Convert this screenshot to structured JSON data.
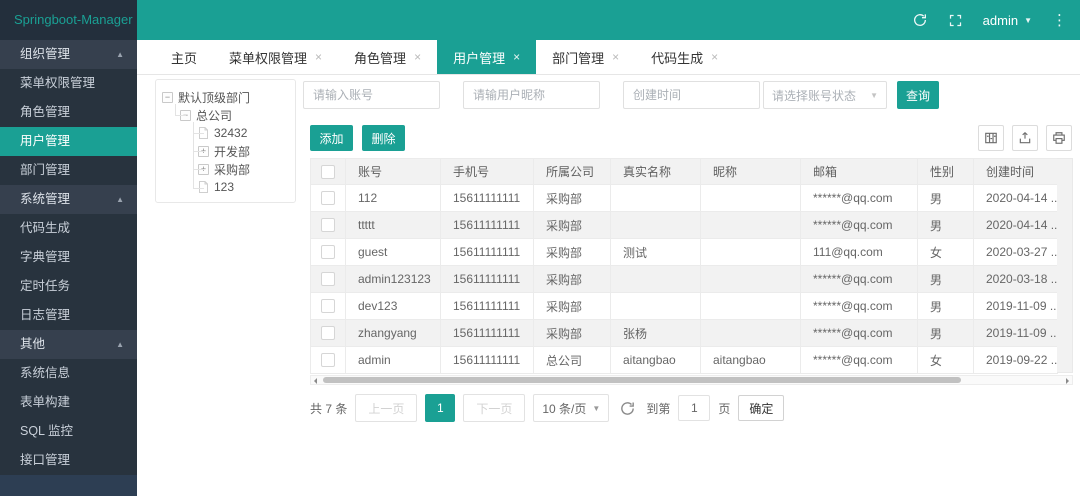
{
  "colors": {
    "primary": "#1AA094",
    "sidebar_bg": "#28333E",
    "sidebar_group_bg": "#36404E",
    "logo_bg": "#232F3C",
    "table_header_bg": "#F2F2F2",
    "border": "#E6E6E6"
  },
  "icons": {
    "close": "×",
    "caret_up": "▲",
    "caret_down": "▼",
    "more_vertical": "⋮",
    "collapse_minus": "−",
    "expand_plus": "+"
  },
  "logo": {
    "title": "Springboot-Manager"
  },
  "topbar": {
    "username": "admin"
  },
  "sidebar": {
    "items": [
      {
        "label": "组织管理",
        "type": "group"
      },
      {
        "label": "菜单权限管理",
        "type": "item"
      },
      {
        "label": "角色管理",
        "type": "item"
      },
      {
        "label": "用户管理",
        "type": "item",
        "active": true
      },
      {
        "label": "部门管理",
        "type": "item"
      },
      {
        "label": "系统管理",
        "type": "group"
      },
      {
        "label": "代码生成",
        "type": "item"
      },
      {
        "label": "字典管理",
        "type": "item"
      },
      {
        "label": "定时任务",
        "type": "item"
      },
      {
        "label": "日志管理",
        "type": "item"
      },
      {
        "label": "其他",
        "type": "group"
      },
      {
        "label": "系统信息",
        "type": "item"
      },
      {
        "label": "表单构建",
        "type": "item"
      },
      {
        "label": "SQL 监控",
        "type": "item"
      },
      {
        "label": "接口管理",
        "type": "item"
      }
    ]
  },
  "tabs": {
    "items": [
      {
        "label": "主页",
        "closable": false,
        "active": false
      },
      {
        "label": "菜单权限管理",
        "closable": true,
        "active": false
      },
      {
        "label": "角色管理",
        "closable": true,
        "active": false
      },
      {
        "label": "用户管理",
        "closable": true,
        "active": true
      },
      {
        "label": "部门管理",
        "closable": true,
        "active": false
      },
      {
        "label": "代码生成",
        "closable": true,
        "active": false
      }
    ]
  },
  "tree": {
    "nodes": [
      {
        "label": "默认顶级部门",
        "icon": "collapse"
      },
      {
        "label": "总公司",
        "icon": "collapse"
      },
      {
        "label": "32432",
        "icon": "file"
      },
      {
        "label": "开发部",
        "icon": "expand"
      },
      {
        "label": "采购部",
        "icon": "expand"
      },
      {
        "label": "123",
        "icon": "file"
      }
    ]
  },
  "filters": {
    "account_placeholder": "请输入账号",
    "nickname_placeholder": "请输用户昵称",
    "create_time_placeholder": "创建时间",
    "status_placeholder": "请选择账号状态",
    "search_label": "查询"
  },
  "toolbar": {
    "add_label": "添加",
    "delete_label": "删除"
  },
  "table": {
    "columns": [
      "账号",
      "手机号",
      "所属公司",
      "真实名称",
      "昵称",
      "邮箱",
      "性别",
      "创建时间"
    ],
    "rows": [
      {
        "account": "112",
        "phone": "15611111111",
        "company": "采购部",
        "realname": "",
        "nickname": "",
        "email": "******@qq.com",
        "gender": "男",
        "created": "2020-04-14 ..."
      },
      {
        "account": "ttttt",
        "phone": "15611111111",
        "company": "采购部",
        "realname": "",
        "nickname": "",
        "email": "******@qq.com",
        "gender": "男",
        "created": "2020-04-14 ..."
      },
      {
        "account": "guest",
        "phone": "15611111111",
        "company": "采购部",
        "realname": "测试",
        "nickname": "",
        "email": "111@qq.com",
        "gender": "女",
        "created": "2020-03-27 ..."
      },
      {
        "account": "admin123123",
        "phone": "15611111111",
        "company": "采购部",
        "realname": "",
        "nickname": "",
        "email": "******@qq.com",
        "gender": "男",
        "created": "2020-03-18 ..."
      },
      {
        "account": "dev123",
        "phone": "15611111111",
        "company": "采购部",
        "realname": "",
        "nickname": "",
        "email": "******@qq.com",
        "gender": "男",
        "created": "2019-11-09 ..."
      },
      {
        "account": "zhangyang",
        "phone": "15611111111",
        "company": "采购部",
        "realname": "张杨",
        "nickname": "",
        "email": "******@qq.com",
        "gender": "男",
        "created": "2019-11-09 ..."
      },
      {
        "account": "admin",
        "phone": "15611111111",
        "company": "总公司",
        "realname": "aitangbao",
        "nickname": "aitangbao",
        "email": "******@qq.com",
        "gender": "女",
        "created": "2019-09-22 ..."
      }
    ]
  },
  "pagination": {
    "total_label": "共 7 条",
    "prev_label": "上一页",
    "current_page": "1",
    "next_label": "下一页",
    "page_size_label": "10 条/页",
    "goto_label": "到第",
    "goto_value": "1",
    "page_unit_label": "页",
    "confirm_label": "确定"
  }
}
